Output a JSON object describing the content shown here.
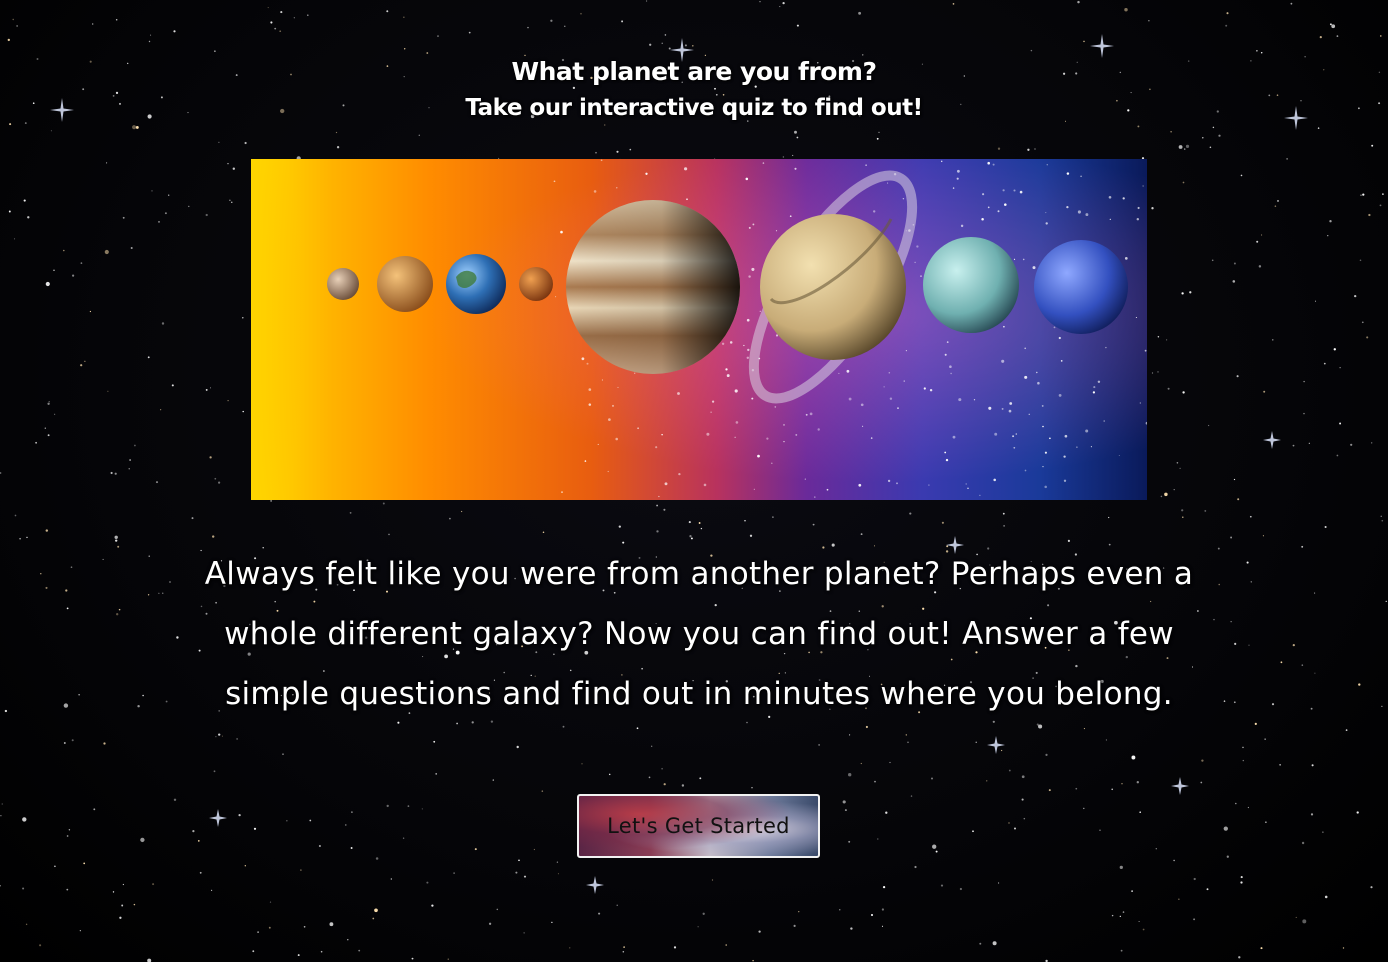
{
  "header": {
    "title": "What planet are you from?",
    "subtitle": "Take our interactive quiz to find out!"
  },
  "banner": {
    "planets": [
      "sun",
      "mercury",
      "venus",
      "earth",
      "mars",
      "jupiter",
      "saturn",
      "uranus",
      "neptune"
    ]
  },
  "intro": {
    "text": "Always felt like you were from another planet? Perhaps even a whole different galaxy? Now you can find out! Answer a few simple questions and find out in minutes where you belong."
  },
  "cta": {
    "label": "Let's Get Started"
  },
  "colors": {
    "background": "#000000",
    "text": "#ffffff",
    "button_border": "#f2f2f2",
    "button_text": "#111111"
  }
}
